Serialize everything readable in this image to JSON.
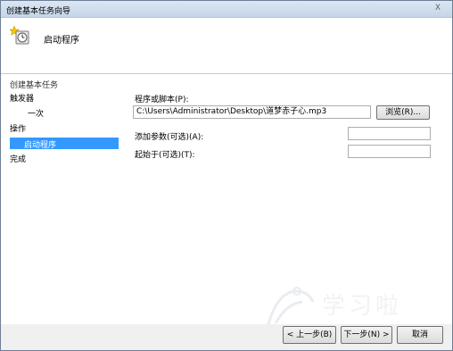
{
  "window": {
    "title": "创建基本任务向导",
    "close_label": "X"
  },
  "header": {
    "title": "启动程序",
    "icon": "clock-star-icon"
  },
  "sidebar": {
    "heading": "创建基本任务",
    "items": [
      {
        "label": "触发器"
      },
      {
        "label": "一次"
      },
      {
        "label": "操作"
      },
      {
        "label": "启动程序"
      },
      {
        "label": "完成"
      }
    ]
  },
  "form": {
    "program_label": "程序或脚本(P):",
    "program_value": "C:\\Users\\Administrator\\Desktop\\道梦赤子心.mp3",
    "browse_label": "浏览(R)...",
    "args_label": "添加参数(可选)(A):",
    "args_value": "",
    "startin_label": "起始于(可选)(T):",
    "startin_value": ""
  },
  "footer": {
    "back_label": "< 上一步(B)",
    "next_label": "下一步(N) >",
    "cancel_label": "取消"
  },
  "watermark": {
    "text": "学习啦"
  }
}
